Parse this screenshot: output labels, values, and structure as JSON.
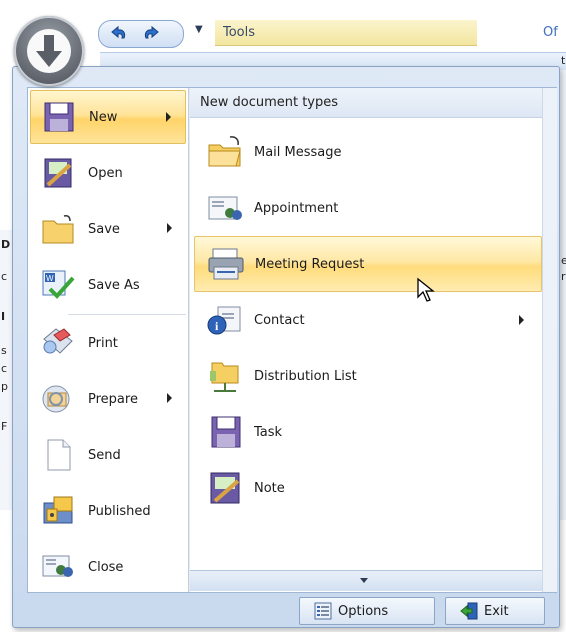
{
  "background": {
    "tools_tab": "Tools",
    "title_fragment": "Of",
    "right_fragments": [
      "t",
      "e",
      "r"
    ],
    "left_fragments": [
      "D",
      "c",
      "I",
      "s",
      "c",
      "p",
      "F"
    ]
  },
  "menu": {
    "left_items": [
      {
        "label": "New",
        "icon": "new-document-icon",
        "has_submenu": true,
        "active": true
      },
      {
        "label": "Open",
        "icon": "open-note-icon",
        "has_submenu": false
      },
      {
        "label": "Save",
        "icon": "save-folder-icon",
        "has_submenu": true
      },
      {
        "label": "Save As",
        "icon": "save-as-icon",
        "has_submenu": false
      },
      {
        "label": "Print",
        "icon": "print-icon",
        "has_submenu": false
      },
      {
        "label": "Prepare",
        "icon": "prepare-icon",
        "has_submenu": true
      },
      {
        "label": "Send",
        "icon": "send-icon",
        "has_submenu": false
      },
      {
        "label": "Published",
        "icon": "published-icon",
        "has_submenu": false
      },
      {
        "label": "Close",
        "icon": "close-doc-icon",
        "has_submenu": false
      }
    ],
    "submenu_header": "New document types",
    "submenu_items": [
      {
        "label": "Mail Message",
        "icon": "mail-message-icon",
        "has_submenu": false
      },
      {
        "label": "Appointment",
        "icon": "appointment-icon",
        "has_submenu": false
      },
      {
        "label": "Meeting Request",
        "icon": "meeting-request-icon",
        "has_submenu": false,
        "hover": true
      },
      {
        "label": "Contact",
        "icon": "contact-icon",
        "has_submenu": true
      },
      {
        "label": "Distribution List",
        "icon": "distribution-list-icon",
        "has_submenu": false
      },
      {
        "label": "Task",
        "icon": "task-icon",
        "has_submenu": false
      },
      {
        "label": "Note",
        "icon": "note-icon",
        "has_submenu": false
      }
    ],
    "footer": {
      "options_label": "Options",
      "exit_label": "Exit"
    }
  },
  "colors": {
    "menu_frame": "#c9d9ee",
    "hover_gold": "#ffdc7c",
    "selected_gold": "#ffd46a",
    "accent_blue": "#3d6fbd"
  }
}
